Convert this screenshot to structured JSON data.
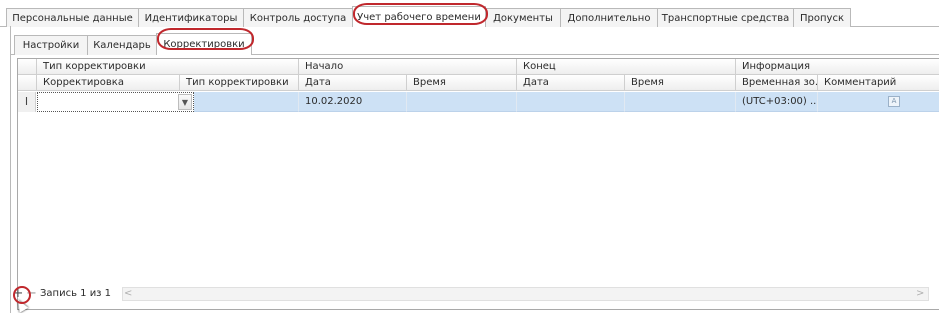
{
  "top_tabs": [
    {
      "label": "Персональные данные"
    },
    {
      "label": "Идентификаторы"
    },
    {
      "label": "Контроль доступа"
    },
    {
      "label": "Учет рабочего времени"
    },
    {
      "label": "Документы"
    },
    {
      "label": "Дополнительно"
    },
    {
      "label": "Транспортные средства"
    },
    {
      "label": "Пропуск"
    }
  ],
  "sub_tabs": [
    {
      "label": "Настройки"
    },
    {
      "label": "Календарь"
    },
    {
      "label": "Корректировки"
    }
  ],
  "grid": {
    "bands": {
      "type": "Тип корректировки",
      "start": "Начало",
      "end": "Конец",
      "info": "Информация"
    },
    "columns": {
      "correction": "Корректировка",
      "correction_type": "Тип корректировки",
      "start_date": "Дата",
      "start_time": "Время",
      "end_date": "Дата",
      "end_time": "Время",
      "timezone": "Временная зо...",
      "comment": "Комментарий"
    },
    "row": {
      "indicator": "I",
      "correction": "",
      "correction_type": "",
      "start_date": "10.02.2020",
      "start_time": "",
      "end_date": "",
      "end_time": "",
      "timezone": "(UTC+03:00) ...",
      "comment": ""
    }
  },
  "navigator": {
    "add": "+",
    "remove": "−",
    "record_text": "Запись 1 из 1",
    "scroll_left": "<",
    "scroll_right": ">"
  },
  "icons": {
    "dropdown": "chevron-down-icon",
    "comment": "memo-icon",
    "cursor": "mouse-pointer-icon"
  },
  "colors": {
    "highlight_ring": "#c0282d",
    "selected_row": "#cde1f5"
  }
}
